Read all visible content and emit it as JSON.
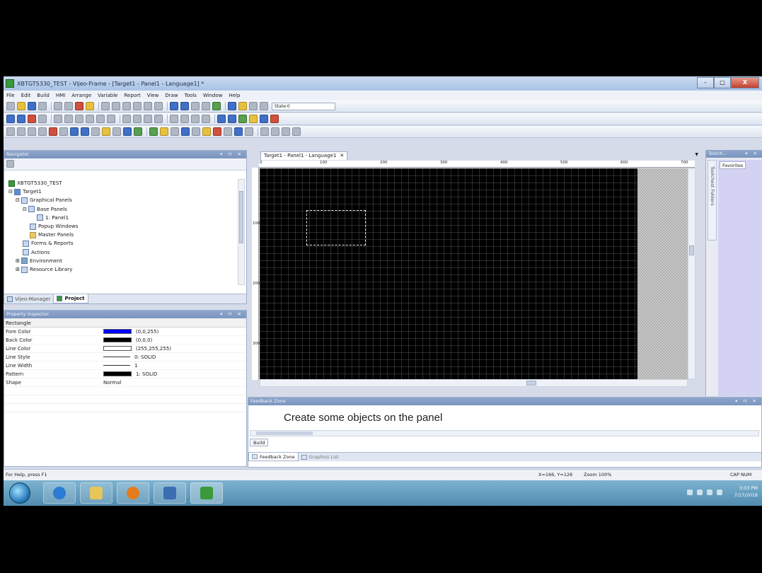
{
  "window": {
    "title": "XBTGT5330_TEST - Vijeo-Frame - [Target1 - Panel1 - Language1] *",
    "min_label": "–",
    "max_label": "□",
    "close_label": "X"
  },
  "menu": [
    "File",
    "Edit",
    "Build",
    "HMI",
    "Arrange",
    "Variable",
    "Report",
    "View",
    "Draw",
    "Tools",
    "Window",
    "Help"
  ],
  "toolbar": {
    "state_value": "State:0"
  },
  "navigator": {
    "title": "Navigator",
    "tree": [
      {
        "label": "XBTGT5330_TEST",
        "prefix": ""
      },
      {
        "label": "Target1",
        "prefix": "⊟"
      },
      {
        "label": "Graphical Panels",
        "prefix": "⊟"
      },
      {
        "label": "Base Panels",
        "prefix": "⊟"
      },
      {
        "label": "1: Panel1",
        "prefix": ""
      },
      {
        "label": "Popup Windows",
        "prefix": ""
      },
      {
        "label": "Master Panels",
        "prefix": ""
      },
      {
        "label": "Forms & Reports",
        "prefix": ""
      },
      {
        "label": "Actions",
        "prefix": ""
      },
      {
        "label": "Environment",
        "prefix": "⊞"
      },
      {
        "label": "Resource Library",
        "prefix": "⊞"
      }
    ],
    "tabs": [
      "Vijeo-Manager",
      "Project"
    ]
  },
  "props": {
    "title": "Property Inspector",
    "object_type": "Rectangle",
    "rows": [
      {
        "name": "Fore Color",
        "value": "(0,0,255)",
        "swatch": "#0000ff"
      },
      {
        "name": "Back Color",
        "value": "(0,0,0)",
        "swatch": "#000000"
      },
      {
        "name": "Line Color",
        "value": "(255,255,255)",
        "swatch": "#ffffff"
      },
      {
        "name": "Line Style",
        "value": "0: SOLID",
        "swatch": "line"
      },
      {
        "name": "Line Width",
        "value": "1",
        "swatch": "line"
      },
      {
        "name": "Pattern",
        "value": "1: SOLID",
        "swatch": "#000000"
      },
      {
        "name": "Shape",
        "value": "Normal",
        "swatch": "none"
      }
    ]
  },
  "document": {
    "tab_title": "Target1 - Panel1 - Language1",
    "ruler_h": [
      "0",
      "100",
      "200",
      "300",
      "400",
      "500",
      "600",
      "700"
    ],
    "ruler_v": [
      "100",
      "200",
      "300"
    ]
  },
  "toolchest": {
    "title": "Toolch...",
    "side_label": "Toolchest Folders",
    "favorites": "Favorites"
  },
  "feedback": {
    "title": "Feedback Zone",
    "message": "Create some objects on the panel",
    "build_label": "Build",
    "tabs": [
      "Feedback Zone",
      "Graphics List"
    ]
  },
  "status": {
    "help": "For Help, press F1",
    "coords": "X=166, Y=126",
    "zoom": "Zoom 100%",
    "indicators": "CAP  NUM  SCR"
  },
  "taskbar": {
    "time": "3:03 PM",
    "date": "7/17/2018"
  }
}
